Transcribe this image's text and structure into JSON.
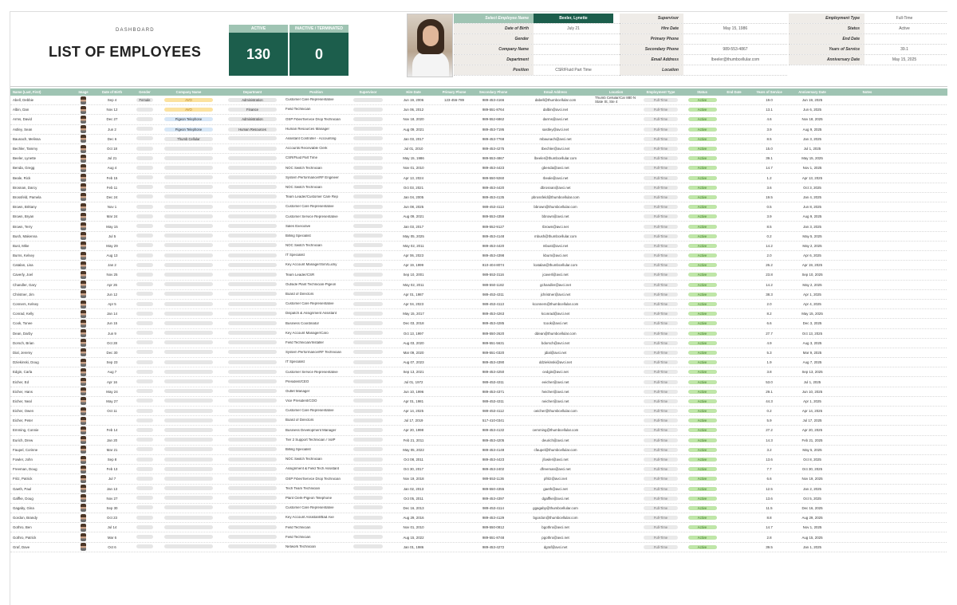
{
  "dashboard_label": "DASHBOARD",
  "title": "LIST OF EMPLOYEES",
  "stats": [
    {
      "label": "ACTIVE",
      "value": "130"
    },
    {
      "label": "INACTIVE / TERMINATED",
      "value": "0"
    }
  ],
  "detail_left": [
    {
      "k": "Select Employee Name",
      "v": "Beeler, Lynette"
    },
    {
      "k": "Date of Birth",
      "v": "July 21"
    },
    {
      "k": "Gender",
      "v": ""
    },
    {
      "k": "Company Name",
      "v": ""
    },
    {
      "k": "Department",
      "v": ""
    },
    {
      "k": "Position",
      "v": "CSR/Fluid Part Time"
    }
  ],
  "detail_mid": [
    {
      "k": "Supervisor",
      "v": ""
    },
    {
      "k": "Hire Date",
      "v": "May 15, 1986"
    },
    {
      "k": "Primary Phone",
      "v": ""
    },
    {
      "k": "Secondary Phone",
      "v": "989-553-4867"
    },
    {
      "k": "Email Address",
      "v": "lbeeler@thumbcellular.com"
    },
    {
      "k": "Location",
      "v": ""
    }
  ],
  "detail_right": [
    {
      "k": "Employment Type",
      "v": "Full-Time"
    },
    {
      "k": "Status",
      "v": "Active"
    },
    {
      "k": "End Date",
      "v": ""
    },
    {
      "k": "Years of Service",
      "v": "39.1"
    },
    {
      "k": "Anniversary Date",
      "v": "May 15, 2025"
    }
  ],
  "columns": [
    "Name (Last, First)",
    "Image",
    "Date of Birth",
    "Gender",
    "Company Name",
    "Department",
    "Position",
    "Supervisor",
    "Hire Date",
    "Primary Phone",
    "Secondary Phone",
    "Email Address",
    "Location",
    "Employment Type",
    "Status",
    "End Date",
    "Years of Service",
    "Anniversary Date",
    "Notes"
  ],
  "rows": [
    [
      "Abell, Debbie",
      "Sep 4",
      "Female",
      "AVO",
      "Administration",
      "Customer Care Representative",
      "Jun 19, 2006",
      "123-456-789",
      "989-453-4166",
      "dabell@thumbcellular.com",
      "Thumb Cellular/Car 880 N State St, Ste 4",
      "Full-Time",
      "Active",
      "19.0",
      "Jun 19, 2025"
    ],
    [
      "Albin, Dan",
      "Nov 12",
      "",
      "AVO",
      "Finance",
      "Field Technician",
      "Jun 06, 2012",
      "",
      "989-551-8764",
      "dalbin@avci.net",
      "",
      "Full-Time",
      "Active",
      "13.1",
      "Jun 6, 2025"
    ],
    [
      "Arms, David",
      "Dec 27",
      "",
      "Pigeon Telephone",
      "Administration",
      "OSP Fiber/Service Drop Technician",
      "Nov 18, 2020",
      "",
      "989-552-6862",
      "darms@avci.net",
      "",
      "Full-Time",
      "Active",
      "4.6",
      "Nov 18, 2025"
    ],
    [
      "Astley, Sean",
      "Jun 2",
      "",
      "Pigeon Telephone",
      "Human Resources",
      "Human Resources Manager",
      "Aug 09, 2021",
      "",
      "989-453-7195",
      "sastley@avci.net",
      "",
      "Full-Time",
      "Active",
      "3.9",
      "Aug 9, 2025"
    ],
    [
      "Baunach, Melissa",
      "Dec 6",
      "",
      "Thumb Cellular",
      "",
      "Assistant Controller - Accounting",
      "Jan 03, 2017",
      "",
      "989-453-7768",
      "mbaunach@avci.net",
      "",
      "Full-Time",
      "Active",
      "8.5",
      "Jan 3, 2025"
    ],
    [
      "Bechler, Tammy",
      "Oct 18",
      "",
      "",
      "",
      "Accounts Receivable Clerk",
      "Jul 01, 2010",
      "",
      "989-453-4275",
      "tbechler@avci.net",
      "",
      "Full-Time",
      "Active",
      "15.0",
      "Jul 1, 2025"
    ],
    [
      "Beeler, Lynette",
      "Jul 21",
      "",
      "",
      "",
      "CSR/Fluid Part Time",
      "May 15, 1986",
      "",
      "989-553-4867",
      "lbeeler@thumbcellular.com",
      "",
      "Full-Time",
      "Active",
      "39.1",
      "May 15, 2025"
    ],
    [
      "Benda, Gregg",
      "Aug 4",
      "",
      "",
      "",
      "NOC Switch Technician",
      "Nov 01, 2010",
      "",
      "989-453-4423",
      "gbenda@avci.net",
      "",
      "Full-Time",
      "Active",
      "14.7",
      "Nov 1, 2025"
    ],
    [
      "Beale, Rick",
      "Feb 15",
      "",
      "",
      "",
      "System Performance/RF Engineer",
      "Apr 13, 2024",
      "",
      "989-550-9260",
      "rbeale@avci.net",
      "",
      "Full-Time",
      "Active",
      "1.2",
      "Apr 13, 2025"
    ],
    [
      "Brosnan, Darcy",
      "Feb 11",
      "",
      "",
      "",
      "NOC Switch Technician",
      "Oct 03, 2021",
      "",
      "989-453-4420",
      "dbrosnan@avci.net",
      "",
      "Full-Time",
      "Active",
      "3.6",
      "Oct 3, 2025"
    ],
    [
      "Brossfeld, Pamela",
      "Dec 24",
      "",
      "",
      "",
      "Team Leader/Customer Care Rep",
      "Jan 04, 2005",
      "",
      "989-453-4135",
      "pbrossfeld@thumbcellular.com",
      "",
      "Full-Time",
      "Active",
      "19.5",
      "Jan 4, 2025"
    ],
    [
      "Brown, Brittany",
      "Nov 1",
      "",
      "",
      "",
      "Customer Care Representative",
      "Jun 08, 2025",
      "",
      "989-453-4113",
      "bbrown@thumbcellular.com",
      "",
      "Full-Time",
      "Active",
      "0.5",
      "Jun 8, 2025"
    ],
    [
      "Brown, Bryan",
      "Mar 24",
      "",
      "",
      "",
      "Customer Service Representative",
      "Aug 09, 2021",
      "",
      "989-553-4359",
      "bbrown@avci.net",
      "",
      "Full-Time",
      "Active",
      "3.9",
      "Aug 9, 2025"
    ],
    [
      "Brown, Terry",
      "May 15",
      "",
      "",
      "",
      "Sales Executive",
      "Jan 03, 2017",
      "",
      "989-552-9127",
      "tbrown@avci.net",
      "",
      "Full-Time",
      "Active",
      "8.5",
      "Jan 3, 2025"
    ],
    [
      "Bush, Makenna",
      "Jul 5",
      "",
      "",
      "",
      "Billing Specialist",
      "May 05, 2025",
      "",
      "989-453-4148",
      "mbush@thumbcellular.com",
      "",
      "Full-Time",
      "Active",
      "0.2",
      "May 5, 2025"
    ],
    [
      "Bust, Mike",
      "May 29",
      "",
      "",
      "",
      "NOC Switch Technician",
      "May 02, 2011",
      "",
      "989-453-4420",
      "mbust@avci.net",
      "",
      "Full-Time",
      "Active",
      "14.2",
      "May 2, 2025"
    ],
    [
      "Burns, Kelsey",
      "Aug 13",
      "",
      "",
      "",
      "IT Specialist",
      "Apr 06, 2023",
      "",
      "989-453-4398",
      "kburn@avci.net",
      "",
      "Full-Time",
      "Active",
      "2.0",
      "Apr 6, 2025"
    ],
    [
      "Catalan, Lisa",
      "Jan 2",
      "",
      "",
      "",
      "Key Account Manager/Sim/Lucky",
      "Apr 19, 1999",
      "",
      "810-404-8074",
      "lcatalan@thumbcellular.com",
      "",
      "Full-Time",
      "Active",
      "26.2",
      "Apr 19, 2025"
    ],
    [
      "Caverly, Joel",
      "Nov 25",
      "",
      "",
      "",
      "Team Leader/CSR",
      "Sep 10, 2001",
      "",
      "989-553-3116",
      "jcaverl@avci.net",
      "",
      "Full-Time",
      "Active",
      "23.8",
      "Sep 10, 2025"
    ],
    [
      "Chandler, Gary",
      "Apr 26",
      "",
      "",
      "",
      "Outside Plant Technician-Pigeon",
      "May 02, 2011",
      "",
      "989-550-1182",
      "gchandler@avci.net",
      "",
      "Full-Time",
      "Active",
      "14.2",
      "May 2, 2025"
    ],
    [
      "Christner, Jim",
      "Jun 12",
      "",
      "",
      "",
      "Board of Directors",
      "Apr 01, 1987",
      "",
      "989-453-4311",
      "jchristner@avci.net",
      "",
      "Full-Time",
      "Active",
      "38.3",
      "Apr 1, 2025"
    ],
    [
      "Conners, Kelsey",
      "Apr 5",
      "",
      "",
      "",
      "Customer Care Representative",
      "Apr 04, 2023",
      "",
      "989-453-4113",
      "kconners@thumbcellular.com",
      "",
      "Full-Time",
      "Active",
      "2.0",
      "Apr 4, 2025"
    ],
    [
      "Conrad, Kelly",
      "Jan 14",
      "",
      "",
      "",
      "Dispatch & Assignment Assistant",
      "May 15, 2017",
      "",
      "989-453-4263",
      "kconrad@avci.net",
      "",
      "Full-Time",
      "Active",
      "8.2",
      "May 15, 2025"
    ],
    [
      "Cook, Tonee",
      "Jun 15",
      "",
      "",
      "",
      "Business Coordinator",
      "Dec 03, 2018",
      "",
      "989-453-4285",
      "tcook@avci.net",
      "",
      "Full-Time",
      "Active",
      "6.6",
      "Dec 3, 2025"
    ],
    [
      "Dean, Darby",
      "Jun 9",
      "",
      "",
      "",
      "Key Account Manager/Caro",
      "Oct 13, 1997",
      "",
      "989-550-2620",
      "ddean@thumbcellular.com",
      "",
      "Full-Time",
      "Active",
      "27.7",
      "Oct 13, 2025"
    ],
    [
      "Dorsch, Brian",
      "Oct 28",
      "",
      "",
      "",
      "Field Technician/Installer",
      "Aug 03, 2020",
      "",
      "989-551-5631",
      "bdorsch@avci.net",
      "",
      "Full-Time",
      "Active",
      "4.9",
      "Aug 3, 2025"
    ],
    [
      "Dial, Jeremy",
      "Dec 30",
      "",
      "",
      "",
      "System Performance/RF Technician",
      "Mar 09, 2020",
      "",
      "989-551-0320",
      "jdial@avci.net",
      "",
      "Full-Time",
      "Active",
      "5.3",
      "Mar 9, 2025"
    ],
    [
      "Dziekinski, Doug",
      "Sep 23",
      "",
      "",
      "",
      "IT Specialist",
      "Aug 07, 2023",
      "",
      "989-453-4390",
      "ddziekinski@avci.net",
      "",
      "Full-Time",
      "Active",
      "1.9",
      "Aug 7, 2025"
    ],
    [
      "Edgin, Carla",
      "Aug 7",
      "",
      "",
      "",
      "Customer Service Representative",
      "Sep 13, 2021",
      "",
      "989-453-4250",
      "cedgin@avci.net",
      "",
      "Full-Time",
      "Active",
      "3.8",
      "Sep 13, 2025"
    ],
    [
      "Eicher, Ed",
      "Apr 16",
      "",
      "",
      "",
      "President/CEO",
      "Jul 01, 1972",
      "",
      "989-453-4311",
      "eeicher@avci.net",
      "",
      "Full-Time",
      "Active",
      "53.0",
      "Jul 1, 2025"
    ],
    [
      "Eicher, Hans",
      "May 24",
      "",
      "",
      "",
      "Outlet Manager",
      "Jun 10, 1996",
      "",
      "989-453-4371",
      "heicher@avci.net",
      "",
      "Full-Time",
      "Active",
      "29.1",
      "Jun 10, 2025"
    ],
    [
      "Eicher, Neal",
      "May 27",
      "",
      "",
      "",
      "Vice President/COO",
      "Apr 01, 1981",
      "",
      "989-453-4311",
      "neicher@avci.net",
      "",
      "Full-Time",
      "Active",
      "44.3",
      "Apr 1, 2025"
    ],
    [
      "Eicher, Owen",
      "Oct 11",
      "",
      "",
      "",
      "Customer Care Representative",
      "Apr 14, 2025",
      "",
      "989-453-4112",
      "oeicher@thumbcellular.com",
      "",
      "Full-Time",
      "Active",
      "0.2",
      "Apr 14, 2025"
    ],
    [
      "Eicher, Peter",
      "",
      "",
      "",
      "",
      "Board of Directors",
      "Jul 17, 2019",
      "",
      "517-410-0341",
      "",
      "",
      "Full-Time",
      "Active",
      "5.9",
      "Jul 17, 2025"
    ],
    [
      "Emming, Connie",
      "Feb 14",
      "",
      "",
      "",
      "Business Development Manager",
      "Apr 20, 1998",
      "",
      "989-453-4132",
      "cemming@thumbcellular.com",
      "",
      "Full-Time",
      "Active",
      "27.2",
      "Apr 20, 2025"
    ],
    [
      "Eurich, Drew",
      "Jan 20",
      "",
      "",
      "",
      "Tier 2 Support Technician / VoIP",
      "Feb 21, 2011",
      "",
      "989-453-4205",
      "deurich@avci.net",
      "",
      "Full-Time",
      "Active",
      "14.3",
      "Feb 21, 2025"
    ],
    [
      "Faupel, Corinne",
      "Mar 21",
      "",
      "",
      "",
      "Billing Specialist",
      "May 05, 2022",
      "",
      "989-453-4148",
      "cfaupel@thumbcellular.com",
      "",
      "Full-Time",
      "Active",
      "3.2",
      "May 5, 2025"
    ],
    [
      "Fowler, John",
      "Sep 8",
      "",
      "",
      "",
      "NOC Switch Technician",
      "Oct 08, 2011",
      "",
      "989-453-4423",
      "jfowler@avci.net",
      "",
      "Full-Time",
      "Active",
      "13.6",
      "Oct 8, 2025"
    ],
    [
      "Freeman, Doug",
      "Feb 13",
      "",
      "",
      "",
      "Assignment & Field Tech Assistant",
      "Oct 30, 2017",
      "",
      "989-453-2402",
      "dfreeman@avci.net",
      "",
      "Full-Time",
      "Active",
      "7.7",
      "Oct 30, 2025"
    ],
    [
      "Fritz, Patrick",
      "Jul 7",
      "",
      "",
      "",
      "OSP Fiber/Service Drop Technician",
      "Nov 19, 2018",
      "",
      "989-553-1136",
      "pfritz@avci.net",
      "",
      "Full-Time",
      "Active",
      "6.6",
      "Nov 19, 2025"
    ],
    [
      "Gaeth, Paul",
      "Jan 13",
      "",
      "",
      "",
      "Tech Team Technician",
      "Jan 02, 2013",
      "",
      "989-550-4355",
      "gaeth@avci.net",
      "",
      "Full-Time",
      "Active",
      "12.5",
      "Jan 2, 2025"
    ],
    [
      "Gaffke, Doug",
      "Nov 27",
      "",
      "",
      "",
      "Plant Clerk-Pigeon Telephone",
      "Oct 05, 2011",
      "",
      "989-453-4397",
      "dgaffke@avci.net",
      "",
      "Full-Time",
      "Active",
      "13.6",
      "Oct 5, 2025"
    ],
    [
      "Gagaby, Gina",
      "Sep 30",
      "",
      "",
      "",
      "Customer Care Representative",
      "Dec 16, 2013",
      "",
      "989-453-4114",
      "ggagaby@thumbcellular.com",
      "",
      "Full-Time",
      "Active",
      "11.5",
      "Dec 16, 2025"
    ],
    [
      "Gordon, Brandy",
      "Oct 23",
      "",
      "",
      "",
      "Key Account Assistant/Bad Axe",
      "Aug 29, 2016",
      "",
      "989-453-4129",
      "bgordon@thumbcellular.com",
      "",
      "Full-Time",
      "Active",
      "8.8",
      "Aug 29, 2025"
    ],
    [
      "Gothro, Ben",
      "Jul 14",
      "",
      "",
      "",
      "Field Technician",
      "Nov 01, 2010",
      "",
      "989-550-0812",
      "bgothro@avci.net",
      "",
      "Full-Time",
      "Active",
      "14.7",
      "Nov 1, 2025"
    ],
    [
      "Gothro, Patrick",
      "Mar 6",
      "",
      "",
      "",
      "Field Technician",
      "Aug 15, 2022",
      "",
      "989-551-8748",
      "pgothro@avci.net",
      "",
      "Full-Time",
      "Active",
      "2.8",
      "Aug 15, 2025"
    ],
    [
      "Graf, Dave",
      "Oct 6",
      "",
      "",
      "",
      "Network Technician",
      "Jan 01, 1986",
      "",
      "989-453-4272",
      "dgraf@avci.net",
      "",
      "Full-Time",
      "Active",
      "39.5",
      "Jan 1, 2025"
    ]
  ],
  "colors": {
    "accent": "#1c5e4c",
    "header": "#9fc4b3",
    "active": "#bfe6a8",
    "company_avo": "#fbe2a0",
    "company_pigeon": "#d6e6f6"
  }
}
